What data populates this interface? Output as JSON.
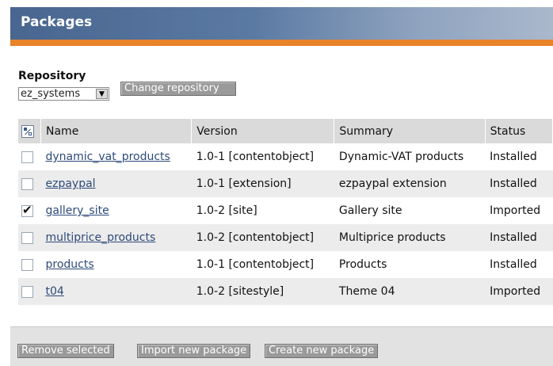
{
  "header": {
    "title": "Packages"
  },
  "repository": {
    "label": "Repository",
    "selected": "ez_systems",
    "change_label": "Change repository"
  },
  "table": {
    "columns": [
      "Name",
      "Version",
      "Summary",
      "Status"
    ],
    "rows": [
      {
        "name": "dynamic_vat_products",
        "version": "1.0-1 [contentobject]",
        "summary": "Dynamic-VAT products",
        "status": "Installed",
        "checked": false
      },
      {
        "name": "ezpaypal",
        "version": "1.0-1 [extension]",
        "summary": "ezpaypal extension",
        "status": "Installed",
        "checked": false
      },
      {
        "name": "gallery_site",
        "version": "1.0-2 [site]",
        "summary": "Gallery site",
        "status": "Imported",
        "checked": true
      },
      {
        "name": "multiprice_products",
        "version": "1.0-2 [contentobject]",
        "summary": "Multiprice products",
        "status": "Installed",
        "checked": false
      },
      {
        "name": "products",
        "version": "1.0-1 [contentobject]",
        "summary": "Products",
        "status": "Installed",
        "checked": false
      },
      {
        "name": "t04",
        "version": "1.0-2 [sitestyle]",
        "summary": "Theme 04",
        "status": "Imported",
        "checked": false
      }
    ]
  },
  "footer": {
    "remove_label": "Remove selected",
    "import_label": "Import new package",
    "create_label": "Create new package"
  },
  "colors": {
    "header_bg": "#48668f",
    "accent_bar": "#e8832a",
    "link": "#2e4a7a",
    "button_bg": "#9a9a9a"
  }
}
